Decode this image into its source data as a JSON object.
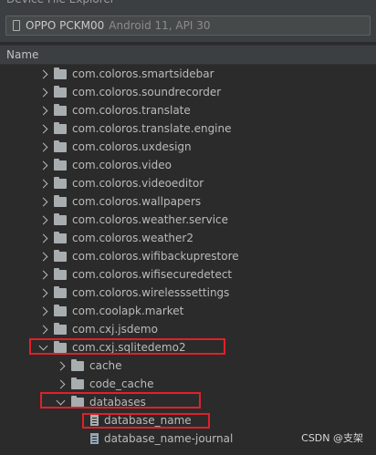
{
  "window": {
    "title": "Device File Explorer"
  },
  "device_selector": {
    "icon": "phone-icon",
    "device": "OPPO PCKM00",
    "api": "Android 11, API 30"
  },
  "column_header": {
    "name": "Name"
  },
  "tree": [
    {
      "label": "com.coloros.smartsidebar",
      "kind": "folder",
      "state": "collapsed",
      "depth": 1
    },
    {
      "label": "com.coloros.soundrecorder",
      "kind": "folder",
      "state": "collapsed",
      "depth": 1
    },
    {
      "label": "com.coloros.translate",
      "kind": "folder",
      "state": "collapsed",
      "depth": 1
    },
    {
      "label": "com.coloros.translate.engine",
      "kind": "folder",
      "state": "collapsed",
      "depth": 1
    },
    {
      "label": "com.coloros.uxdesign",
      "kind": "folder",
      "state": "collapsed",
      "depth": 1
    },
    {
      "label": "com.coloros.video",
      "kind": "folder",
      "state": "collapsed",
      "depth": 1
    },
    {
      "label": "com.coloros.videoeditor",
      "kind": "folder",
      "state": "collapsed",
      "depth": 1
    },
    {
      "label": "com.coloros.wallpapers",
      "kind": "folder",
      "state": "collapsed",
      "depth": 1
    },
    {
      "label": "com.coloros.weather.service",
      "kind": "folder",
      "state": "collapsed",
      "depth": 1
    },
    {
      "label": "com.coloros.weather2",
      "kind": "folder",
      "state": "collapsed",
      "depth": 1
    },
    {
      "label": "com.coloros.wifibackuprestore",
      "kind": "folder",
      "state": "collapsed",
      "depth": 1
    },
    {
      "label": "com.coloros.wifisecuredetect",
      "kind": "folder",
      "state": "collapsed",
      "depth": 1
    },
    {
      "label": "com.coloros.wirelesssettings",
      "kind": "folder",
      "state": "collapsed",
      "depth": 1
    },
    {
      "label": "com.coolapk.market",
      "kind": "folder",
      "state": "collapsed",
      "depth": 1
    },
    {
      "label": "com.cxj.jsdemo",
      "kind": "folder",
      "state": "collapsed",
      "depth": 1
    },
    {
      "label": "com.cxj.sqlitedemo2",
      "kind": "folder",
      "state": "expanded",
      "depth": 1,
      "highlighted": true
    },
    {
      "label": "cache",
      "kind": "folder",
      "state": "collapsed",
      "depth": 2
    },
    {
      "label": "code_cache",
      "kind": "folder",
      "state": "collapsed",
      "depth": 2
    },
    {
      "label": "databases",
      "kind": "folder",
      "state": "expanded",
      "depth": 2,
      "highlighted": true
    },
    {
      "label": "database_name",
      "kind": "file",
      "depth": 3,
      "highlighted": true
    },
    {
      "label": "database_name-journal",
      "kind": "file-journal",
      "depth": 3
    }
  ],
  "watermark": "CSDN @支架",
  "colors": {
    "background": "#2b2b2b",
    "panel": "#3c3f41",
    "text": "#bbbbbb",
    "highlight_box": "#e0202a"
  }
}
